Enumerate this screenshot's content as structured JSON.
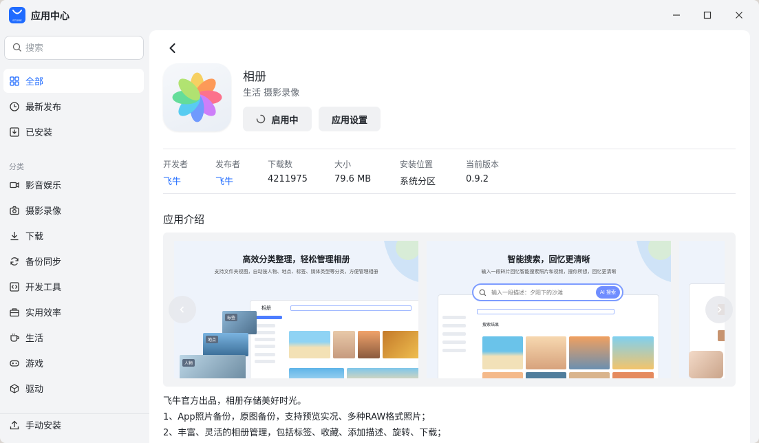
{
  "window": {
    "title": "应用中心",
    "logo_text": "STORE"
  },
  "search": {
    "placeholder": "搜索"
  },
  "sidebar": {
    "top_items": [
      {
        "label": "全部",
        "icon": "grid-icon",
        "active": true
      },
      {
        "label": "最新发布",
        "icon": "clock-icon"
      },
      {
        "label": "已安装",
        "icon": "installed-icon"
      }
    ],
    "section_title": "分类",
    "categories": [
      {
        "label": "影音娱乐",
        "icon": "video-icon"
      },
      {
        "label": "摄影录像",
        "icon": "camera-icon"
      },
      {
        "label": "下载",
        "icon": "download-icon"
      },
      {
        "label": "备份同步",
        "icon": "sync-icon"
      },
      {
        "label": "开发工具",
        "icon": "code-icon"
      },
      {
        "label": "实用效率",
        "icon": "toolbox-icon"
      },
      {
        "label": "生活",
        "icon": "cup-icon"
      },
      {
        "label": "游戏",
        "icon": "gamepad-icon"
      },
      {
        "label": "驱动",
        "icon": "cube-icon"
      }
    ],
    "bottom_item": {
      "label": "手动安装",
      "icon": "upload-icon"
    }
  },
  "app": {
    "name": "相册",
    "categories": "生活 摄影录像",
    "launch_label": "启用中",
    "settings_label": "应用设置"
  },
  "meta": [
    {
      "key": "开发者",
      "value": "飞牛",
      "link": true
    },
    {
      "key": "发布者",
      "value": "飞牛",
      "link": true
    },
    {
      "key": "下载数",
      "value": "4211975"
    },
    {
      "key": "大小",
      "value": "79.6 MB"
    },
    {
      "key": "安装位置",
      "value": "系统分区"
    },
    {
      "key": "当前版本",
      "value": "0.9.2"
    }
  ],
  "intro": {
    "title": "应用介绍",
    "screenshots": [
      {
        "title": "高效分类整理，轻松管理相册",
        "subtitle": "支持文件夹视图，自动按人物、地点、标签、媒体类型等分类，方便管理相册",
        "mock_title": "相册",
        "tags": [
          "标签",
          "地点",
          "人物"
        ]
      },
      {
        "title": "智能搜索，回忆更清晰",
        "subtitle": "输入一段碎片回忆智能搜索照片和视频，搜你所想，回忆更清晰",
        "search_text": "输入一段描述：夕阳下的沙滩",
        "ai_label": "AI 搜索",
        "result_label": "搜索结果"
      }
    ],
    "description": [
      "飞牛官方出品，相册存储美好时光。",
      "1、App照片备份，原图备份，支持预览实况、多种RAW格式照片；",
      "2、丰富、灵活的相册管理，包括标签、收藏、添加描述、旋转、下载；"
    ]
  },
  "colors": {
    "accent": "#1f6bff",
    "sidebar_bg": "#f3f4f6",
    "main_bg": "#ffffff"
  }
}
